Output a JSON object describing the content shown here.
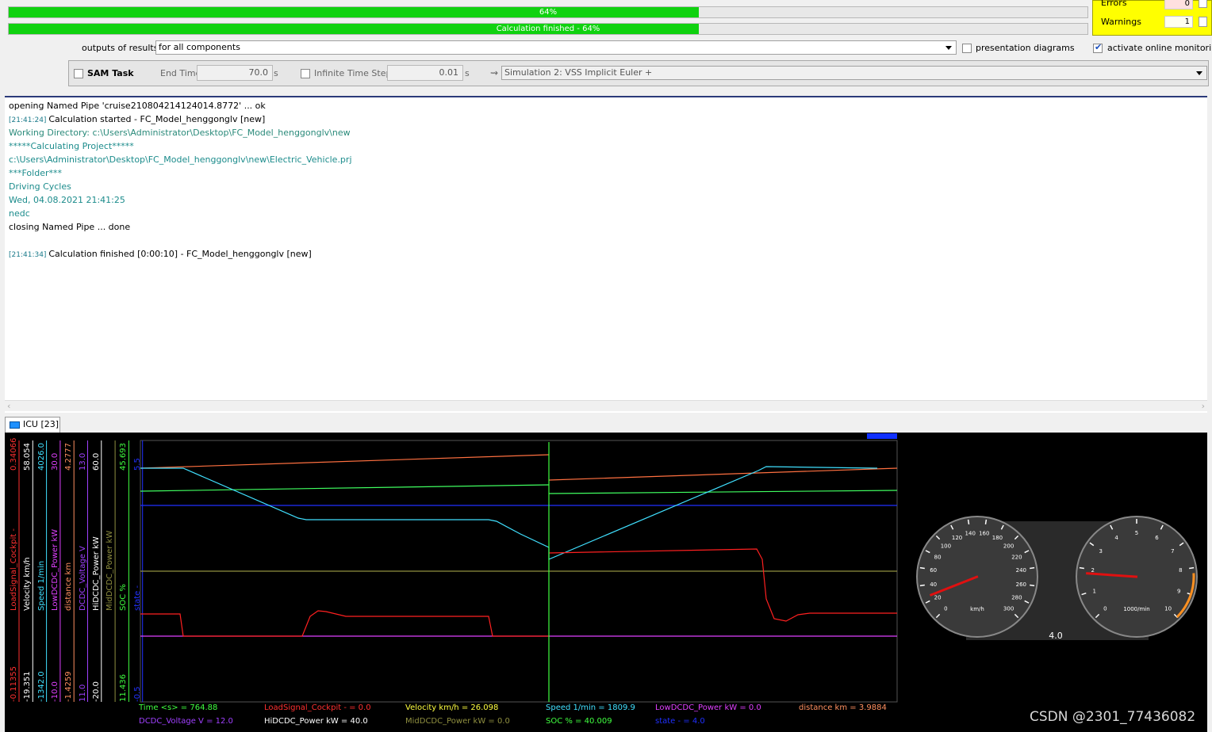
{
  "progress": {
    "bar1_text": "64%",
    "bar2_text": "Calculation finished - 64%",
    "value": 0.64
  },
  "status": {
    "errors_label": "Errors",
    "errors_value": "0",
    "warnings_label": "Warnings",
    "warnings_value": "1"
  },
  "outputs": {
    "label": "outputs of results",
    "value": "for all components",
    "presentation_label": "presentation diagrams",
    "monitoring_label": "activate online monitoring"
  },
  "sam": {
    "task_label": "SAM Task",
    "end_time_label": "End Time",
    "end_time_value": "70.0",
    "end_time_unit": "s",
    "infinite_label": "Infinite",
    "time_step_label": "Time Step",
    "time_step_value": "0.01",
    "time_step_unit": "s",
    "simulation_value": "Simulation 2: VSS Implicit Euler +"
  },
  "log": [
    {
      "ts": "",
      "text": "opening Named Pipe 'cruise210804214124014.8772' ... ok",
      "style": "black"
    },
    {
      "ts": "[21:41:24]",
      "text": "Calculation started - FC_Model_henggonglv [new]",
      "style": "black"
    },
    {
      "ts": "",
      "text": "Working Directory: c:\\Users\\Administrator\\Desktop\\FC_Model_henggonglv\\new",
      "style": "dkteal"
    },
    {
      "ts": "",
      "text": "*****Calculating Project*****",
      "style": "teal"
    },
    {
      "ts": "",
      "text": "c:\\Users\\Administrator\\Desktop\\FC_Model_henggonglv\\new\\Electric_Vehicle.prj",
      "style": "teal"
    },
    {
      "ts": "",
      "text": "***Folder***",
      "style": "teal"
    },
    {
      "ts": "",
      "text": "Driving Cycles",
      "style": "teal"
    },
    {
      "ts": "",
      "text": "Wed, 04.08.2021 21:41:25",
      "style": "teal"
    },
    {
      "ts": "",
      "text": "nedc",
      "style": "teal"
    },
    {
      "ts": "",
      "text": "closing Named Pipe ... done",
      "style": "black"
    },
    {
      "ts": "",
      "text": "",
      "style": "black"
    },
    {
      "ts": "[21:41:34]",
      "text": "Calculation finished [0:00:10] - FC_Model_henggonglv [new]",
      "style": "black"
    }
  ],
  "icu_tab": "ICU [23]",
  "axes": [
    {
      "label": "LoadSignal_Cockpit -",
      "max": "0.34066",
      "min": "-0.11355",
      "color": "#ff3030"
    },
    {
      "label": "Velocity km/h",
      "max": "58.054",
      "min": "-19.351",
      "color": "#ffffff"
    },
    {
      "label": "Speed 1/min",
      "max": "4026.0",
      "min": "-1342.0",
      "color": "#40e0ff"
    },
    {
      "label": "LowDCDC_Power kW",
      "max": "30.0",
      "min": "-10.0",
      "color": "#e040ff"
    },
    {
      "label": "distance km",
      "max": "4.2777",
      "min": "-1.4259",
      "color": "#ff9060"
    },
    {
      "label": "DCDC_Voltage V",
      "max": "13.0",
      "min": "11.0",
      "color": "#a040ff"
    },
    {
      "label": "HiDCDC_Power kW",
      "max": "60.0",
      "min": "-20.0",
      "color": "#ffffff"
    },
    {
      "label": "MidDCDC_Power kW",
      "max": "",
      "min": "",
      "color": "#909040"
    },
    {
      "label": "SOC %",
      "max": "45.693",
      "min": "11.436",
      "color": "#40ff40"
    },
    {
      "label": "state -",
      "max": "5.5",
      "min": "-0.5",
      "color": "#2030ff"
    }
  ],
  "readouts": [
    {
      "text": "Time <s> = 764.88",
      "color": "#40ff40"
    },
    {
      "text": "LoadSignal_Cockpit - = 0.0",
      "color": "#ff3030"
    },
    {
      "text": "Velocity km/h = 26.098",
      "color": "#ffff40"
    },
    {
      "text": "Speed 1/min = 1809.9",
      "color": "#40e0ff"
    },
    {
      "text": "LowDCDC_Power kW = 0.0",
      "color": "#e040ff"
    },
    {
      "text": "distance km = 3.9884",
      "color": "#ff9060"
    },
    {
      "text": "DCDC_Voltage V = 12.0",
      "color": "#a040ff"
    },
    {
      "text": "HiDCDC_Power kW = 40.0",
      "color": "#ffffff"
    },
    {
      "text": "MidDCDC_Power kW = 0.0",
      "color": "#909040"
    },
    {
      "text": "SOC % = 40.009",
      "color": "#40ff40"
    },
    {
      "text": "state - = 4.0",
      "color": "#2030ff"
    }
  ],
  "gauges": {
    "speed_unit": "km/h",
    "speed_ticks": [
      "0",
      "20",
      "40",
      "60",
      "80",
      "100",
      "120",
      "140",
      "160",
      "180",
      "200",
      "220",
      "240",
      "260",
      "280",
      "300"
    ],
    "speed_value": 26.098,
    "rpm_unit": "1000/min",
    "rpm_ticks": [
      "0",
      "1",
      "2",
      "3",
      "4",
      "5",
      "6",
      "7",
      "8",
      "9",
      "10"
    ],
    "rpm_value": 1.8099,
    "display": "4.0"
  },
  "watermark": "CSDN @2301_77436082",
  "colors": {
    "progress": "#0fd20f",
    "status_panel": "#ffff00"
  }
}
